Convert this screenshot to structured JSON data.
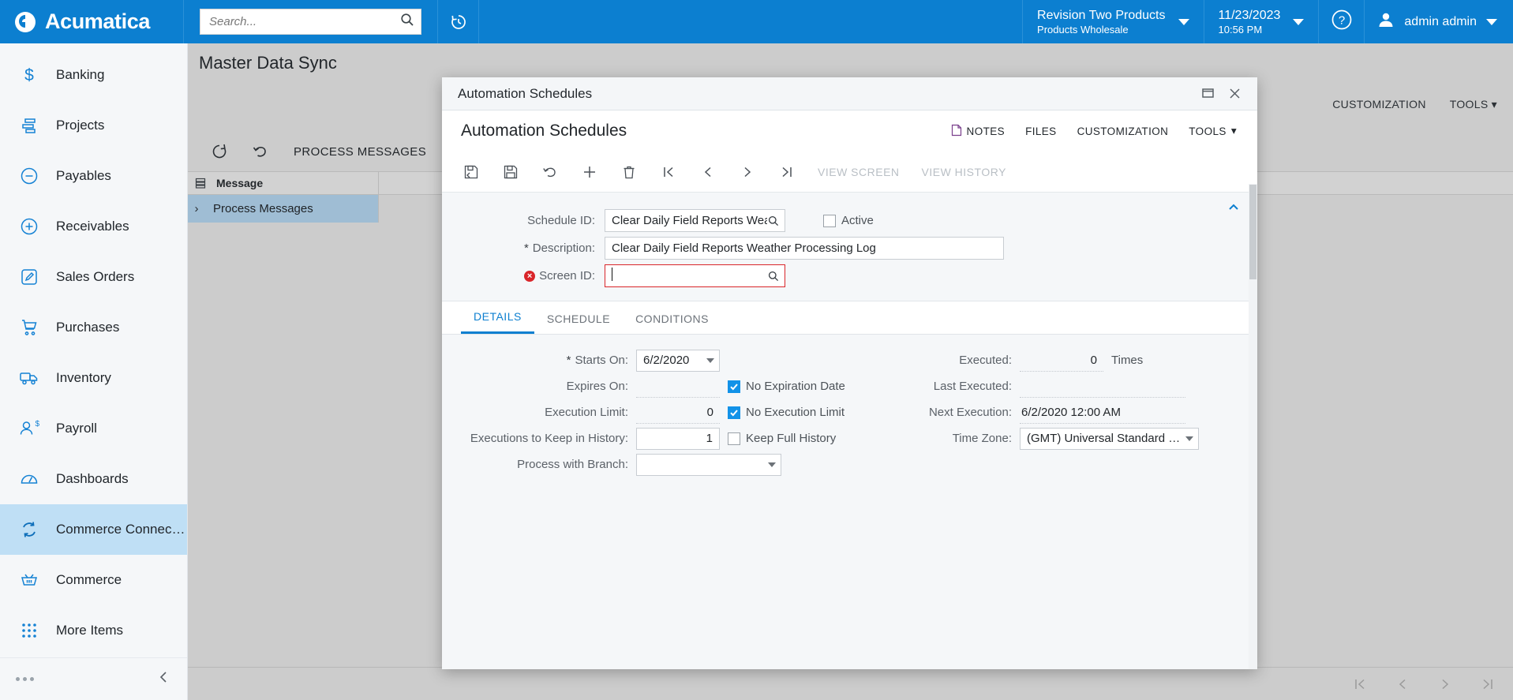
{
  "topbar": {
    "brand": "Acumatica",
    "brand_logo_icon": "acumatica-logo-icon",
    "search_placeholder": "Search...",
    "search_value": "",
    "search_icon": "search-icon",
    "recent_icon": "recent-history-icon",
    "company": {
      "name": "Revision Two Products",
      "branch": "Products Wholesale",
      "chevron_icon": "chevron-down-icon"
    },
    "datetime": {
      "date": "11/23/2023",
      "time": "10:56 PM",
      "chevron_icon": "chevron-down-icon"
    },
    "help_icon": "help-circle-icon",
    "user": {
      "name": "admin admin",
      "avatar_icon": "user-avatar-icon",
      "chevron_icon": "chevron-down-icon"
    }
  },
  "sidebar": {
    "items": [
      {
        "label": "Banking",
        "icon": "dollar-sign-icon",
        "active": false
      },
      {
        "label": "Projects",
        "icon": "gantt-chart-icon",
        "active": false
      },
      {
        "label": "Payables",
        "icon": "minus-circle-icon",
        "active": false
      },
      {
        "label": "Receivables",
        "icon": "plus-circle-icon",
        "active": false
      },
      {
        "label": "Sales Orders",
        "icon": "pencil-square-icon",
        "active": false
      },
      {
        "label": "Purchases",
        "icon": "shopping-cart-icon",
        "active": false
      },
      {
        "label": "Inventory",
        "icon": "truck-icon",
        "active": false
      },
      {
        "label": "Payroll",
        "icon": "person-dollar-icon",
        "active": false
      },
      {
        "label": "Dashboards",
        "icon": "gauge-icon",
        "active": false
      },
      {
        "label": "Commerce Connec…",
        "icon": "sync-arrows-icon",
        "active": true
      },
      {
        "label": "Commerce",
        "icon": "basket-icon",
        "active": false
      },
      {
        "label": "More Items",
        "icon": "grid-dots-icon",
        "active": false
      }
    ],
    "footer": {
      "more_icon": "ellipsis-icon",
      "collapse_icon": "chevron-left-icon"
    }
  },
  "page": {
    "title": "Master Data Sync",
    "header_actions": [
      {
        "label": "CUSTOMIZATION"
      },
      {
        "label": "TOOLS",
        "caret": true
      }
    ],
    "toolbar": {
      "refresh_icon": "refresh-icon",
      "undo_icon": "undo-icon",
      "process_messages_label": "PROCESS MESSAGES"
    },
    "grid": {
      "column_settings_icon": "column-settings-icon",
      "header": "Message",
      "rows": [
        {
          "expand_icon": "chevron-right-icon",
          "message": "Process Messages",
          "selected": true
        }
      ]
    },
    "statusbar": {
      "first_icon": "first-page-icon",
      "prev_icon": "prev-page-icon",
      "next_icon": "next-page-icon",
      "last_icon": "last-page-icon"
    }
  },
  "modal": {
    "window_title": "Automation Schedules",
    "restore_icon": "restore-window-icon",
    "close_icon": "close-icon",
    "heading": "Automation Schedules",
    "head_actions": [
      {
        "label": "NOTES",
        "icon": "note-page-icon"
      },
      {
        "label": "FILES",
        "icon": null
      },
      {
        "label": "CUSTOMIZATION",
        "icon": null
      },
      {
        "label": "TOOLS",
        "icon": null,
        "caret": true
      }
    ],
    "toolbar": {
      "icons": [
        {
          "name": "save-and-close-icon"
        },
        {
          "name": "save-icon"
        },
        {
          "name": "undo-icon"
        },
        {
          "name": "add-new-icon"
        },
        {
          "name": "delete-icon"
        },
        {
          "name": "first-record-icon"
        },
        {
          "name": "prev-record-icon"
        },
        {
          "name": "next-record-icon"
        },
        {
          "name": "last-record-icon"
        }
      ],
      "view_screen_label": "VIEW SCREEN",
      "view_history_label": "VIEW HISTORY"
    },
    "form": {
      "collapse_icon": "chevron-up-icon",
      "schedule_id": {
        "label": "Schedule ID:",
        "value": "Clear Daily Field Reports Wea",
        "lookup_icon": "magnifier-icon"
      },
      "active": {
        "label": "Active",
        "checked": false
      },
      "description": {
        "label": "Description:",
        "required": true,
        "value": "Clear Daily Field Reports Weather Processing Log"
      },
      "screen_id": {
        "label": "Screen ID:",
        "error": true,
        "error_icon": "error-badge-icon",
        "value": "",
        "lookup_icon": "magnifier-icon",
        "focused": true
      }
    },
    "tabs": [
      {
        "label": "DETAILS",
        "active": true
      },
      {
        "label": "SCHEDULE",
        "active": false
      },
      {
        "label": "CONDITIONS",
        "active": false
      }
    ],
    "details": {
      "left": [
        {
          "label": "Starts On:",
          "required": true,
          "value": "6/2/2020",
          "type": "date"
        },
        {
          "label": "Expires On:",
          "required": false,
          "value": "",
          "type": "ghost",
          "checkbox": {
            "label": "No Expiration Date",
            "checked": true
          }
        },
        {
          "label": "Execution Limit:",
          "required": false,
          "value": "0",
          "type": "numghost",
          "checkbox": {
            "label": "No Execution Limit",
            "checked": true
          }
        },
        {
          "label": "Executions to Keep in History:",
          "required": false,
          "value": "1",
          "type": "numbox",
          "checkbox": {
            "label": "Keep Full History",
            "checked": false
          }
        },
        {
          "label": "Process with Branch:",
          "required": false,
          "value": "",
          "type": "select"
        }
      ],
      "right": [
        {
          "label": "Executed:",
          "value": "0",
          "type": "numghost",
          "unit": "Times"
        },
        {
          "label": "Last Executed:",
          "value": "",
          "type": "ghost"
        },
        {
          "label": "Next Execution:",
          "value": "6/2/2020 12:00 AM",
          "type": "ghost"
        },
        {
          "label": "Time Zone:",
          "value": "(GMT) Universal Standard …",
          "type": "select"
        }
      ]
    }
  },
  "colors": {
    "brand_blue": "#0c7fd0",
    "accent_blue": "#1292e8",
    "sidebar_active": "#bfdff5",
    "error_red": "#d9252a",
    "page_gray": "#cccccc"
  }
}
